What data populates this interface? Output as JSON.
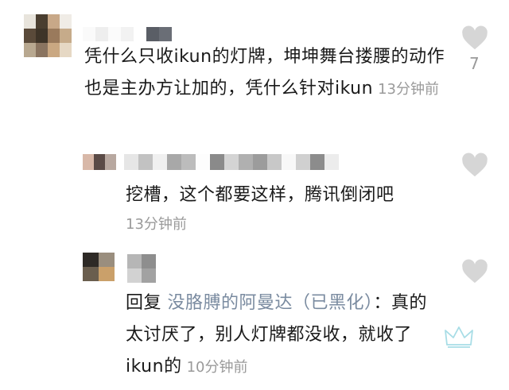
{
  "comments": [
    {
      "text": "凭什么只收ikun的灯牌，坤坤舞台搂腰的动作也是主办方让加的，凭什么针对ikun",
      "time": "13分钟前",
      "likes": "7"
    },
    {
      "text": "挖槽，这个都要这样，腾讯倒闭吧",
      "time": "13分钟前"
    },
    {
      "reply_prefix": "回复",
      "reply_to": "没胳膊的阿曼达（已黑化）",
      "text": "：真的太讨厌了，别人灯牌都没收，就收了ikun的",
      "time": "10分钟前"
    }
  ],
  "icons": {
    "like": "heart-outline-icon",
    "badge": "crown-icon"
  },
  "colors": {
    "text": "#1a1a1a",
    "timestamp": "#9a9a9a",
    "reply_name": "#7a8ba0",
    "heart": "#cfcfcf",
    "crown": "#a8dde6"
  }
}
